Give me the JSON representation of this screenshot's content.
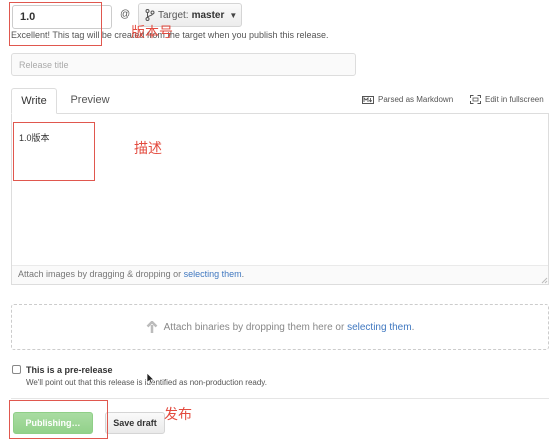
{
  "tag": {
    "value": "1.0",
    "at_sign": "@",
    "target_label": "Target:",
    "target_branch": "master",
    "hint": "Excellent! This tag will be created from the target when you publish this release."
  },
  "title": {
    "placeholder": "Release title"
  },
  "tabs": [
    {
      "label": "Write",
      "active": true
    },
    {
      "label": "Preview",
      "active": false
    }
  ],
  "toolbar": {
    "markdown_label": "Parsed as Markdown",
    "fullscreen_label": "Edit in fullscreen"
  },
  "editor": {
    "content": "1.0版本",
    "attach_prefix": "Attach images by dragging & dropping or ",
    "attach_link": "selecting them",
    "attach_suffix": "."
  },
  "binaries": {
    "prefix": "Attach binaries by dropping them here or ",
    "link": "selecting them",
    "suffix": "."
  },
  "prerelease": {
    "label": "This is a pre-release",
    "note": "We'll point out that this release is identified as non-production ready.",
    "checked": false
  },
  "actions": {
    "publish_label": "Publishing…",
    "save_draft_label": "Save draft"
  },
  "annotations": {
    "version": "版本号",
    "description": "描述",
    "publish": "发布"
  },
  "colors": {
    "annotation": "#e34b3f",
    "publish_green": "#92d18a",
    "link_blue": "#4078c0"
  },
  "icons": {
    "branch": "branch-icon",
    "markdown": "markdown-icon",
    "fullscreen": "fullscreen-icon",
    "upload": "upload-arrow-icon",
    "cursor": "mouse-cursor-icon"
  }
}
